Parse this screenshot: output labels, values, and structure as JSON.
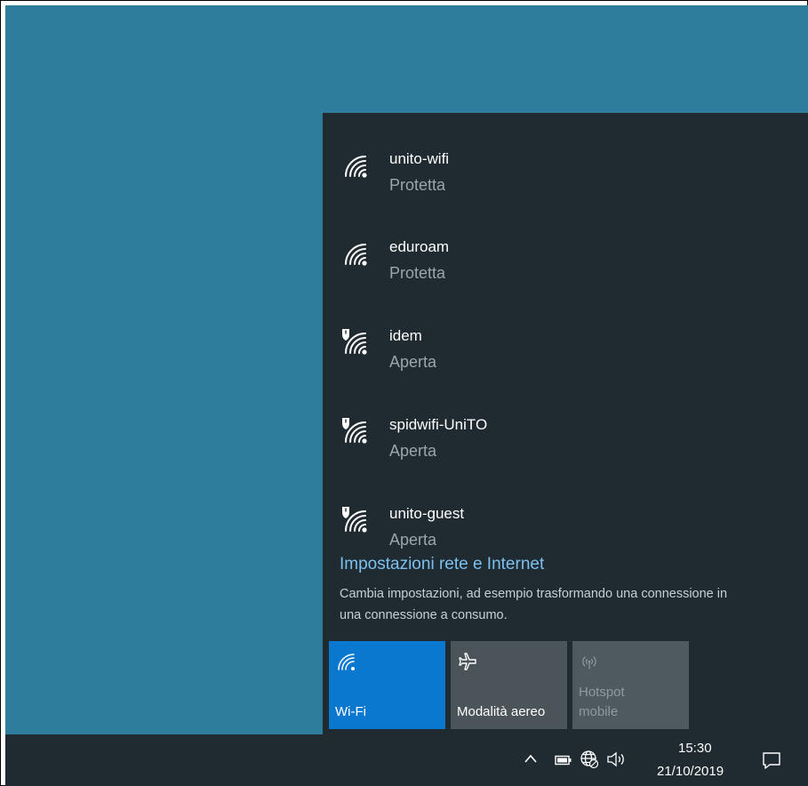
{
  "networks": [
    {
      "name": "unito-wifi",
      "status": "Protetta",
      "icon": "wifi-icon"
    },
    {
      "name": "eduroam",
      "status": "Protetta",
      "icon": "wifi-icon"
    },
    {
      "name": "idem",
      "status": "Aperta",
      "icon": "wifi-open-warning-icon"
    },
    {
      "name": "spidwifi-UniTO",
      "status": "Aperta",
      "icon": "wifi-open-warning-icon"
    },
    {
      "name": "unito-guest",
      "status": "Aperta",
      "icon": "wifi-open-warning-icon"
    }
  ],
  "settings": {
    "link": "Impostazioni rete e Internet",
    "description": "Cambia impostazioni, ad esempio trasformando una connessione in una connessione a consumo."
  },
  "quick_actions": {
    "wifi": {
      "label": "Wi-Fi",
      "active": true
    },
    "airplane": {
      "label": "Modalità aereo",
      "active": false
    },
    "hotspot": {
      "label_line1": "Hotspot",
      "label_line2": "mobile",
      "enabled": false
    }
  },
  "taskbar": {
    "time": "15:30",
    "date": "21/10/2019",
    "icons": [
      "chevron-up-icon",
      "battery-icon",
      "globe-network-icon",
      "speaker-icon",
      "notification-icon"
    ]
  },
  "colors": {
    "desktop": "#2e7d9c",
    "flyout": "#1f2b31",
    "accent": "#0b78d0",
    "link": "#7cc0f0"
  }
}
